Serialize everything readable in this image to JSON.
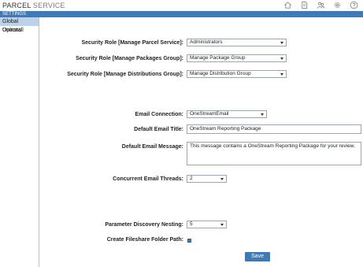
{
  "app": {
    "title_main": "PARCEL",
    "title_sub": "SERVICE"
  },
  "header_icons": [
    "home-icon",
    "page-icon",
    "people-icon",
    "gear-icon",
    "help-icon"
  ],
  "settings_bar": {
    "label": "SETTINGS"
  },
  "sidebar": {
    "items": [
      {
        "label": "Global Options",
        "active": true
      },
      {
        "label": "Uninstall",
        "active": false
      }
    ]
  },
  "form": {
    "security_parcel": {
      "label": "Security Role [Manage Parcel Service]:",
      "value": "Administrators"
    },
    "security_packages": {
      "label": "Security Role [Manage Packages Group]:",
      "value": "Manage Package Group"
    },
    "security_distributions": {
      "label": "Security Role [Manage Distributions Group]:",
      "value": "Manage Distribution Group"
    },
    "email_connection": {
      "label": "Email Connection:",
      "value": "OneStreamEmail"
    },
    "email_title": {
      "label": "Default Email Title:",
      "value": "OneStream Reporting Package"
    },
    "email_message": {
      "label": "Default Email Message:",
      "value": "This message contains a OneStream Reporting Package for your review."
    },
    "concurrent_threads": {
      "label": "Concurrent Email Threads:",
      "value": "2"
    },
    "param_nesting": {
      "label": "Parameter Discovery Nesting:",
      "value": "5"
    },
    "fileshare_path": {
      "label": "Create Fileshare Folder Path:",
      "checked": true
    }
  },
  "actions": {
    "save_label": "Save"
  },
  "colors": {
    "accent": "#3f7ab8",
    "sidebar_active": "#bcd2ea"
  }
}
